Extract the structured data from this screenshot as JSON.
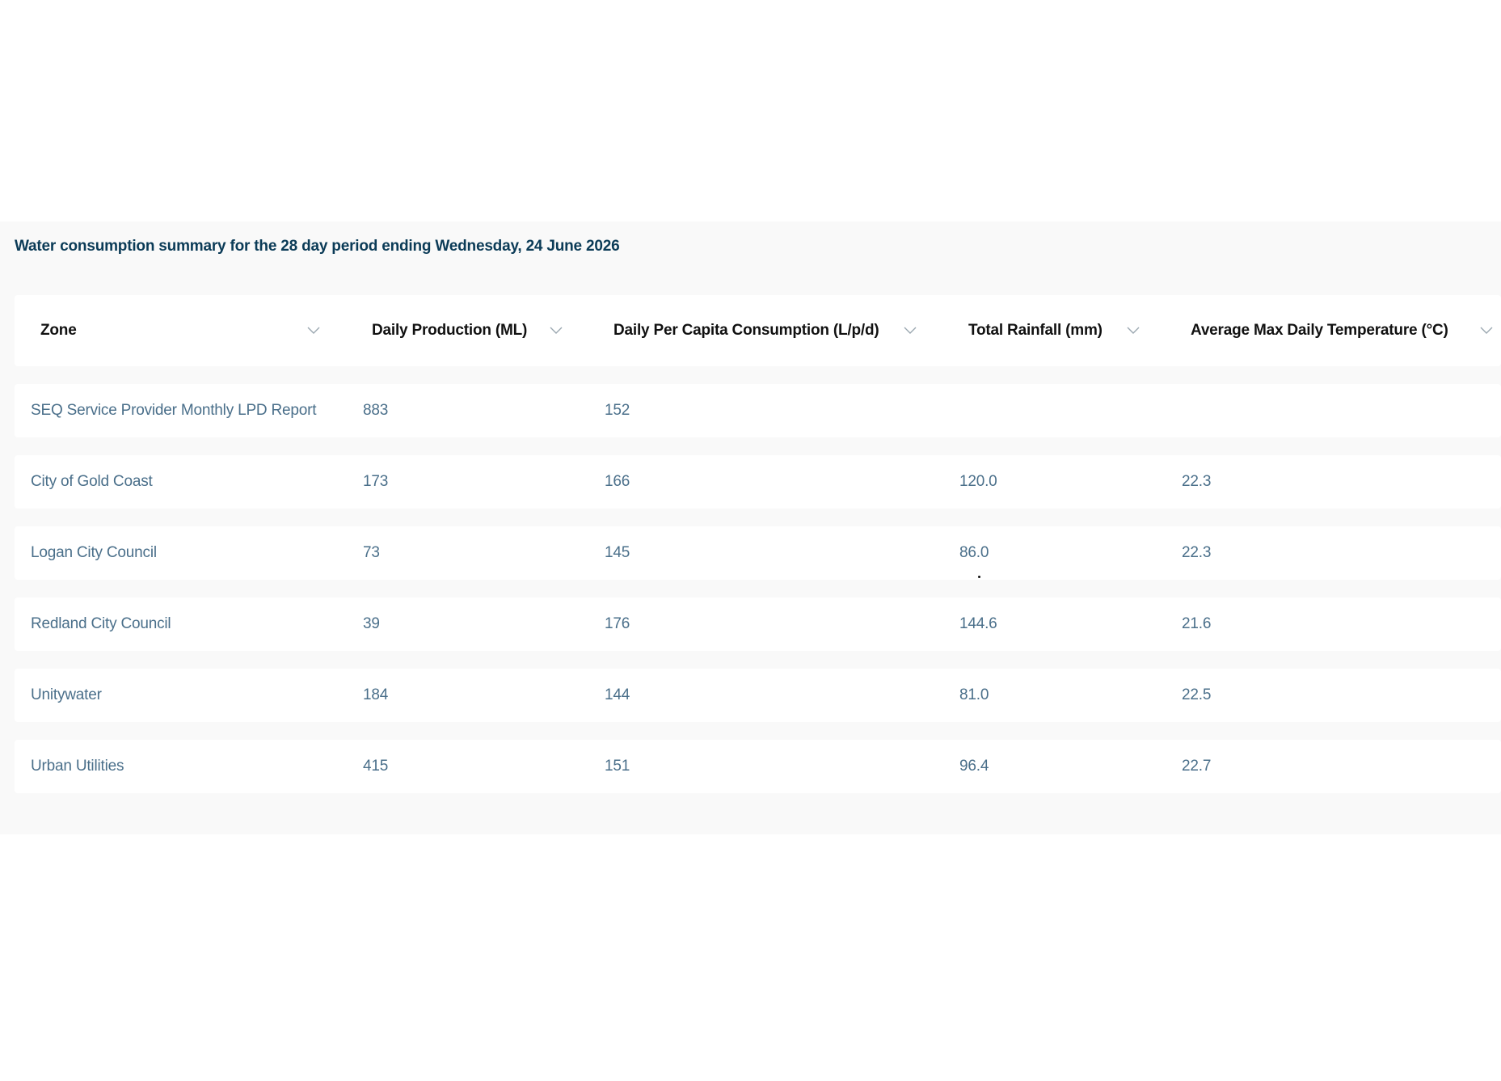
{
  "summary": {
    "title": "Water consumption summary for the 28 day period ending Wednesday, 24 June 2026"
  },
  "table": {
    "columns": [
      {
        "label": "Zone",
        "icon": "chevron-down-icon"
      },
      {
        "label": "Daily Production (ML)",
        "icon": "chevron-down-icon"
      },
      {
        "label": "Daily Per Capita Consumption (L/p/d)",
        "icon": "chevron-down-icon"
      },
      {
        "label": "Total Rainfall (mm)",
        "icon": "chevron-down-icon"
      },
      {
        "label": "Average Max Daily Temperature (°C)",
        "icon": "chevron-down-icon"
      }
    ],
    "rows": [
      {
        "zone": "SEQ Service Provider Monthly LPD Report",
        "production": "883",
        "per_capita": "152",
        "rainfall": "",
        "temperature": ""
      },
      {
        "zone": "City of Gold Coast",
        "production": "173",
        "per_capita": "166",
        "rainfall": "120.0",
        "temperature": "22.3"
      },
      {
        "zone": "Logan City Council",
        "production": "73",
        "per_capita": "145",
        "rainfall": "86.0",
        "temperature": "22.3"
      },
      {
        "zone": "Redland City Council",
        "production": "39",
        "per_capita": "176",
        "rainfall": "144.6",
        "temperature": "21.6"
      },
      {
        "zone": "Unitywater",
        "production": "184",
        "per_capita": "144",
        "rainfall": "81.0",
        "temperature": "22.5"
      },
      {
        "zone": "Urban Utilities",
        "production": "415",
        "per_capita": "151",
        "rainfall": "96.4",
        "temperature": "22.7"
      }
    ]
  },
  "colors": {
    "title": "#0b3b57",
    "cell_text": "#4a6f8a",
    "header_text": "#111111",
    "section_bg": "#f9f9f9",
    "row_bg": "#ffffff"
  }
}
